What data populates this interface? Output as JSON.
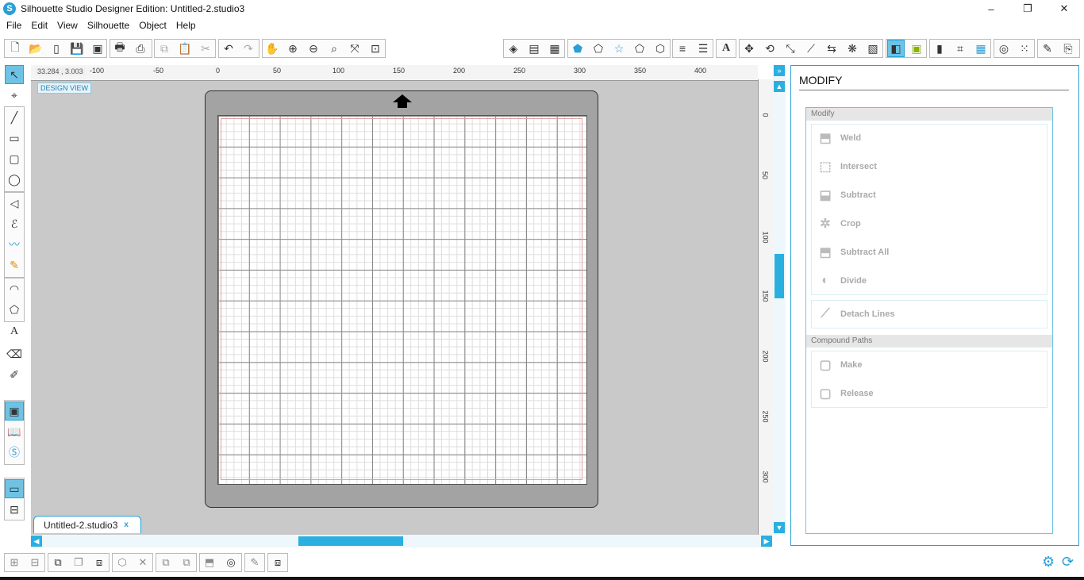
{
  "window": {
    "title": "Silhouette Studio Designer Edition: Untitled-2.studio3",
    "app_icon_letter": "S",
    "controls": {
      "minimize": "–",
      "maximize": "❐",
      "close": "✕"
    }
  },
  "menu": [
    "File",
    "Edit",
    "View",
    "Silhouette",
    "Object",
    "Help"
  ],
  "toolbar": {
    "file_icons": [
      "new-doc-icon",
      "open-icon",
      "template-icon",
      "save-icon",
      "save-library-icon"
    ],
    "print_icons": [
      "print-icon",
      "send-cut-icon"
    ],
    "clipboard_icons": [
      "copy-icon",
      "paste-icon",
      "cut-icon"
    ],
    "history_icons": [
      "undo-icon",
      "redo-icon"
    ],
    "view_icons": [
      "pan-icon",
      "zoom-in-icon",
      "zoom-out-icon",
      "zoom-select-icon",
      "drag-zoom-icon",
      "fit-page-icon"
    ],
    "panel_icons": [
      "fill-color-icon",
      "gradient-icon",
      "pattern-icon",
      "line-color-icon",
      "line-style-icon",
      "line-effect-icon",
      "page-setup-icon",
      "offset-icon",
      "trace-icon",
      "replicate-icon",
      "modify-icon"
    ]
  },
  "left_tools": [
    "select-tool",
    "edit-points-tool",
    "line-tool",
    "rectangle-tool",
    "rounded-rectangle-tool",
    "ellipse-tool",
    "polygon-tool",
    "curve-tool",
    "freehand-tool",
    "smooth-freehand-tool",
    "arc-tool",
    "regular-polygon-tool",
    "text-tool",
    "eraser-tool",
    "knife-tool",
    "design-view-tool",
    "library-tool",
    "store-tool",
    "page-tool",
    "split-view-tool"
  ],
  "canvas": {
    "coords": "33.284 , 3.003",
    "design_view_label": "DESIGN VIEW",
    "ruler_h_labels": [
      "-100",
      "-50",
      "0",
      "50",
      "100",
      "150",
      "200",
      "250",
      "300",
      "350",
      "400"
    ],
    "ruler_v_labels": [
      "0",
      "50",
      "100",
      "150",
      "200",
      "250",
      "300"
    ]
  },
  "doc_tab": {
    "label": "Untitled-2.studio3",
    "close": "x"
  },
  "panel": {
    "title": "MODIFY",
    "modify_section": "Modify",
    "modify_items": [
      "Weld",
      "Intersect",
      "Subtract",
      "Crop",
      "Subtract All",
      "Divide"
    ],
    "detach_label": "Detach Lines",
    "compound_section": "Compound Paths",
    "compound_items": [
      "Make",
      "Release"
    ]
  },
  "colors": {
    "accent": "#2a9fd6",
    "scroll_thumb": "#2ab0e0",
    "canvas_bg": "#c9c9c9",
    "mat": "#a3a3a3"
  },
  "scroll": {
    "horizontal_thumb_position": 0.36,
    "vertical_thumb_position": 0.4
  }
}
